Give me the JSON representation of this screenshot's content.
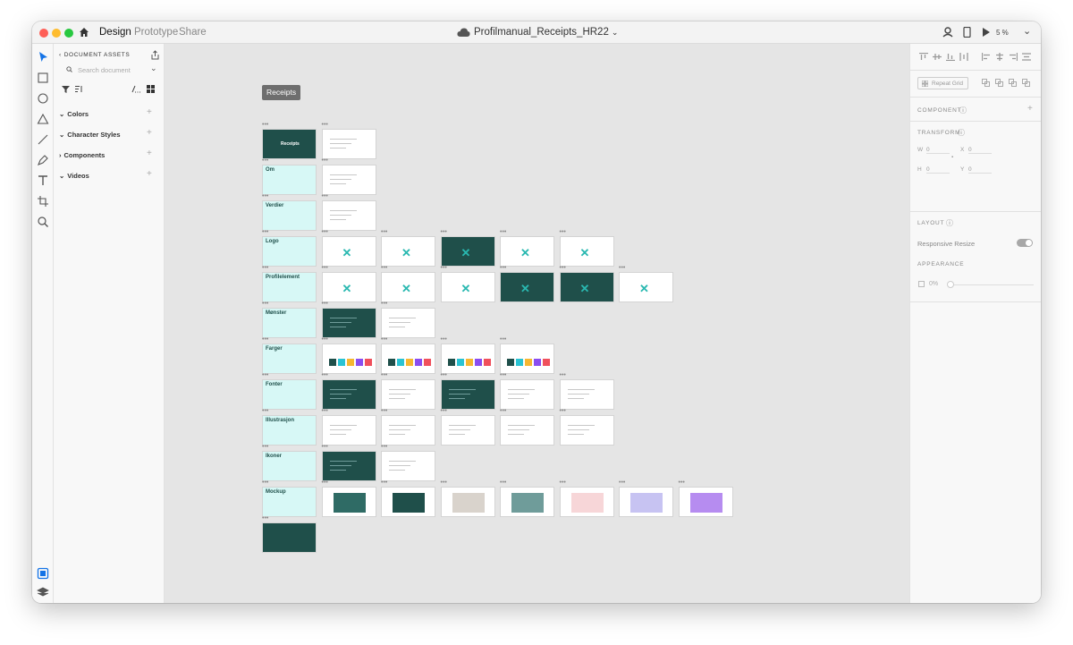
{
  "titlebar": {
    "tabs": [
      "Design",
      "Prototype",
      "Share"
    ],
    "file_name": "Profilmanual_Receipts_HR22",
    "zoom": "5 %"
  },
  "left_panel": {
    "header": "DOCUMENT ASSETS",
    "search_placeholder": "Search document",
    "sections": [
      "Colors",
      "Character Styles",
      "Components",
      "Videos"
    ]
  },
  "canvas": {
    "group_label": "Receipts",
    "rows": [
      {
        "label": "",
        "count": 2
      },
      {
        "label": "Om",
        "count": 1
      },
      {
        "label": "Verdier",
        "count": 1
      },
      {
        "label": "Logo",
        "count": 5
      },
      {
        "label": "Profilelement",
        "count": 6
      },
      {
        "label": "Mønster",
        "count": 2
      },
      {
        "label": "Farger",
        "count": 4
      },
      {
        "label": "Fonter",
        "count": 5
      },
      {
        "label": "Illustrasjon",
        "count": 5
      },
      {
        "label": "Ikoner",
        "count": 2
      },
      {
        "label": "Mockup",
        "count": 7
      }
    ],
    "cover_title": "Receipts",
    "logo_text": "Receipts"
  },
  "right_panel": {
    "repeat_grid": "Repeat Grid",
    "component": "COMPONENT",
    "transform": "TRANSFORM",
    "w": "W",
    "w_val": "0",
    "x": "X",
    "x_val": "0",
    "h": "H",
    "h_val": "0",
    "y": "Y",
    "y_val": "0",
    "layout": "LAYOUT",
    "responsive_resize": "Responsive Resize",
    "appearance": "APPEARANCE",
    "opacity": "0%"
  },
  "colors": {
    "accent": "#1473e6",
    "brand_dark": "#1f4f4a",
    "brand_cyan": "#d7f8f6"
  }
}
